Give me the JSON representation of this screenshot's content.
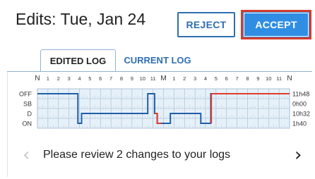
{
  "header": {
    "title": "Edits: Tue, Jan 24",
    "reject_label": "REJECT",
    "accept_label": "ACCEPT"
  },
  "tabs": [
    {
      "label": "EDITED LOG",
      "active": true
    },
    {
      "label": "CURRENT LOG",
      "active": false
    }
  ],
  "grid": {
    "hour_labels": [
      "N",
      "1",
      "2",
      "3",
      "4",
      "5",
      "6",
      "7",
      "8",
      "9",
      "10",
      "11",
      "M",
      "1",
      "2",
      "3",
      "4",
      "5",
      "6",
      "7",
      "8",
      "9",
      "10",
      "11",
      "N"
    ],
    "status_rows": [
      {
        "label": "OFF",
        "total": "11h48"
      },
      {
        "label": "SB",
        "total": "0h00"
      },
      {
        "label": "D",
        "total": "10h32"
      },
      {
        "label": "ON",
        "total": "1h40"
      }
    ]
  },
  "message": {
    "text": "Please review 2 changes to your logs",
    "prev_icon": "chevron-left-icon",
    "next_icon": "chevron-right-icon"
  },
  "colors": {
    "accent_blue": "#2f8ee4",
    "brand_blue": "#2e6fb1",
    "accept_border": "#d83c2b",
    "grid_fill": "#e6f0f8",
    "log_line": "#1f5fa8",
    "edit_line": "#e03a2f"
  },
  "chart_data": {
    "type": "line",
    "x_unit": "hours",
    "xlim": [
      0,
      24
    ],
    "y_categories": [
      "OFF",
      "SB",
      "D",
      "ON"
    ],
    "series": [
      {
        "color": "#1f5fa8",
        "steps": [
          {
            "start": 0,
            "end": 3.85,
            "status": "OFF"
          },
          {
            "start": 3.85,
            "end": 4.2,
            "status": "ON"
          },
          {
            "start": 4.2,
            "end": 10.5,
            "status": "D"
          },
          {
            "start": 10.5,
            "end": 11.15,
            "status": "OFF"
          },
          {
            "start": 11.15,
            "end": 11.4,
            "status": "D"
          },
          {
            "start": 11.4,
            "end": 12.65,
            "status": "ON"
          },
          {
            "start": 12.65,
            "end": 15.55,
            "status": "D"
          },
          {
            "start": 15.55,
            "end": 16.5,
            "status": "ON"
          },
          {
            "start": 16.5,
            "end": 24,
            "status": "OFF"
          }
        ]
      },
      {
        "color": "#e03a2f",
        "steps": [
          {
            "start": 11.15,
            "end": 11.4,
            "status": "D"
          },
          {
            "start": 11.4,
            "end": 11.8,
            "status": "ON"
          }
        ]
      }
    ]
  }
}
